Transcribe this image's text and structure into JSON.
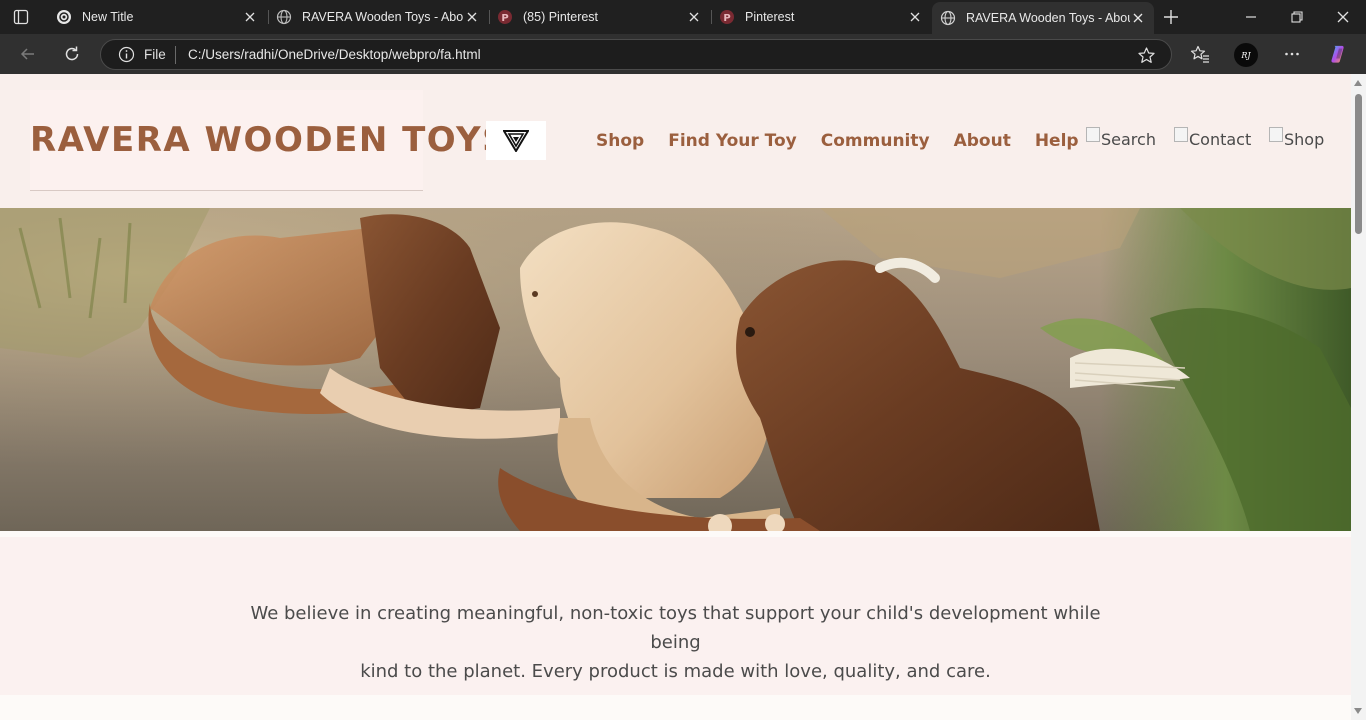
{
  "browser": {
    "tabs": [
      {
        "title": "New Title",
        "icon": "openai-icon",
        "active": false
      },
      {
        "title": "RAVERA Wooden Toys - About",
        "icon": "globe-icon",
        "active": false
      },
      {
        "title": "(85) Pinterest",
        "icon": "pinterest-icon",
        "active": false
      },
      {
        "title": "Pinterest",
        "icon": "pinterest-icon",
        "active": false
      },
      {
        "title": "RAVERA Wooden Toys - About",
        "icon": "globe-icon",
        "active": true
      }
    ],
    "address": {
      "scheme_label": "File",
      "url": "C:/Users/radhi/OneDrive/Desktop/webpro/fa.html"
    },
    "profile_initials": "RJ"
  },
  "site": {
    "logo": "RAVERA WOODEN TOYS",
    "nav": [
      "Shop",
      "Find Your Toy",
      "Community",
      "About",
      "Help"
    ],
    "header_icons": [
      {
        "alt": "Search"
      },
      {
        "alt": "Contact"
      },
      {
        "alt": "Shop"
      }
    ],
    "mission_line1": "We believe in creating meaningful, non-toxic toys that support your child's development while being",
    "mission_line2": "kind to the planet. Every product is made with love, quality, and care."
  },
  "colors": {
    "accent": "#9b5f3e",
    "header_bg": "#f9efec",
    "band_bg": "#fbf1f0"
  }
}
